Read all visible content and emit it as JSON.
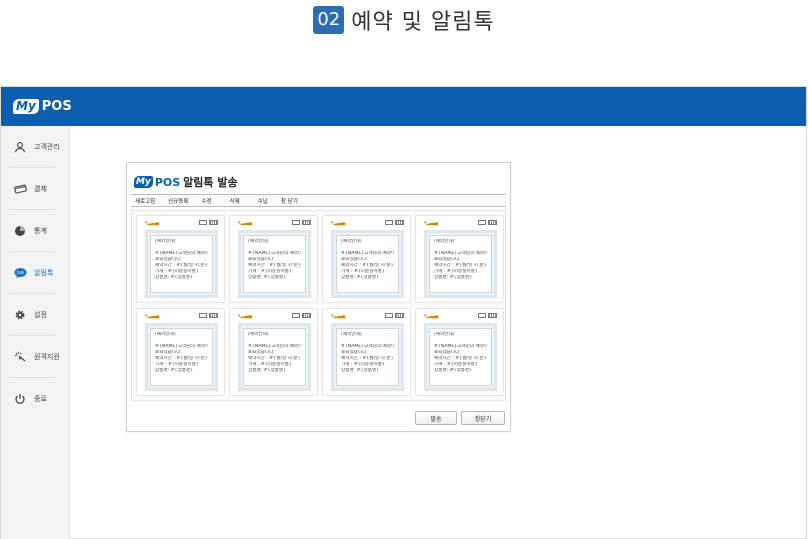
{
  "heading": {
    "number": "02",
    "title": "예약 및 알림톡"
  },
  "app": {
    "logo_my": "My",
    "logo_pos": "POS"
  },
  "sidebar": {
    "items": [
      {
        "label": "고객관리",
        "icon": "person-icon"
      },
      {
        "label": "결제",
        "icon": "payment-icon"
      },
      {
        "label": "통계",
        "icon": "pie-chart-icon"
      },
      {
        "label": "알림톡",
        "icon": "talk-bubble-icon",
        "active": true
      },
      {
        "label": "설정",
        "icon": "gear-icon"
      },
      {
        "label": "원격지원",
        "icon": "remote-support-icon"
      },
      {
        "label": "종료",
        "icon": "power-icon"
      }
    ]
  },
  "dialog": {
    "logo_my": "My",
    "logo_pos": "POS",
    "title": "알림톡 발송",
    "menu": [
      "새로고침",
      "신규등록",
      "수정",
      "삭제",
      "수납",
      "창 닫기"
    ],
    "cards": [
      {
        "header": "[예약안내]",
        "lines": [
          "#{NAME}고객님의 예약이 완",
          "료되었습니다.",
          "예약시간 : #{월/일 시:분}",
          "가게 : #{미용실이름}",
          "상품명: #{상품명}"
        ]
      },
      {
        "header": "[예약안내]",
        "lines": [
          "#{NAME}고객님의 예약이 완",
          "료되었습니다.",
          "예약시간 : #{월/일 시:분}",
          "가게 : #{미용실이름}",
          "상품명: #{상품명}"
        ]
      },
      {
        "header": "[예약안내]",
        "lines": [
          "#{NAME}고객님의 예약이 완",
          "료되었습니다.",
          "예약시간 : #{월/일 시:분}",
          "가게 : #{미용실이름}",
          "상품명: #{상품명}"
        ]
      },
      {
        "header": "[예약안내]",
        "lines": [
          "#{NAME}고객님의 예약이 완",
          "료되었습니다.",
          "예약시간 : #{월/일 시:분}",
          "가게 : #{미용실이름}",
          "상품명: #{상품명}"
        ]
      },
      {
        "header": "[예약안내]",
        "lines": [
          "#{NAME}고객님의 예약이 완",
          "료되었습니다.",
          "예약시간 : #{월/일 시:분}",
          "가게 : #{미용실이름}",
          "상품명: #{상품명}"
        ]
      },
      {
        "header": "[예약안내]",
        "lines": [
          "#{NAME}고객님의 예약이 완",
          "료되었습니다.",
          "예약시간 : #{월/일 시:분}",
          "가게 : #{미용실이름}",
          "상품명: #{상품명}"
        ]
      },
      {
        "header": "[예약안내]",
        "lines": [
          "#{NAME}고객님의 예약이 완",
          "료되었습니다.",
          "예약시간 : #{월/일 시:분}",
          "가게 : #{미용실이름}",
          "상품명: #{상품명}"
        ]
      },
      {
        "header": "[예약안내]",
        "lines": [
          "#{NAME}고객님의 예약이 완",
          "료되었습니다.",
          "예약시간 : #{월/일 시:분}",
          "가게 : #{미용실이름}",
          "상품명: #{상품명}"
        ]
      }
    ],
    "buttons": {
      "send": "발송",
      "close": "창닫기"
    }
  },
  "colors": {
    "brand_blue": "#0b5fae",
    "heading_badge": "#2d6db3",
    "active_item": "#1a6fc0"
  }
}
